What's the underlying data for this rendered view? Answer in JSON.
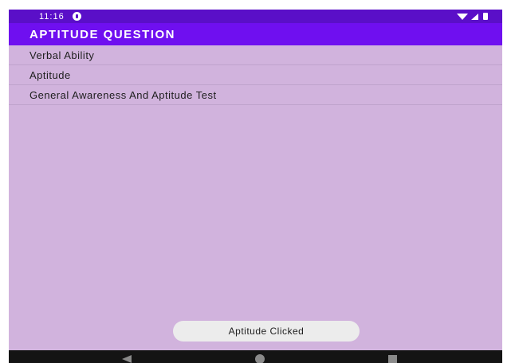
{
  "status_bar": {
    "time": "11:16",
    "notification_icon": "notification-dot-icon",
    "wifi_icon": "wifi-icon",
    "signal_icon": "signal-icon",
    "battery_icon": "battery-icon"
  },
  "app_bar": {
    "title": "APTITUDE QUESTION"
  },
  "list": {
    "items": [
      {
        "label": "Verbal Ability"
      },
      {
        "label": "Aptitude"
      },
      {
        "label": "General Awareness And Aptitude Test"
      }
    ]
  },
  "toast": {
    "message": "Aptitude Clicked"
  },
  "nav_bar": {
    "back_icon": "back-triangle-icon",
    "home_icon": "home-circle-icon",
    "recents_icon": "recents-square-icon"
  },
  "colors": {
    "status_bar": "#5a0fc8",
    "app_bar": "#6f0ff0",
    "background": "#d1b3dd",
    "toast": "#ececec",
    "nav_bar": "#141414"
  }
}
